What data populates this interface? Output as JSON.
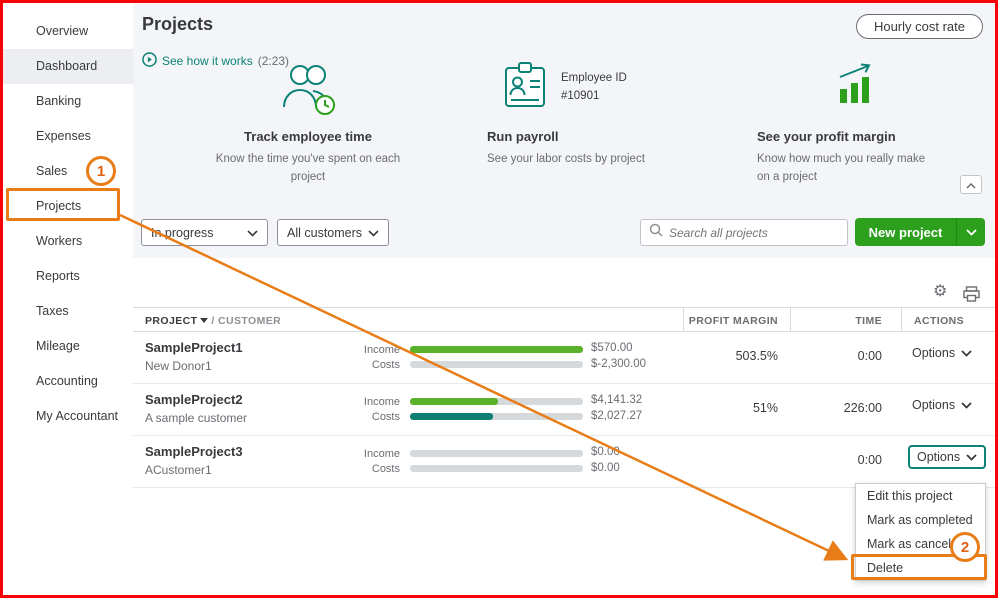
{
  "colors": {
    "accent_green": "#2ca01c",
    "teal": "#0c8276",
    "income_bar_green": "#5bb12a",
    "costs_bar_teal": "#0f7e72",
    "annotation_orange": "#e87d17",
    "frame_border_red": "#fb0007"
  },
  "sidebar": {
    "items": [
      {
        "label": "Overview"
      },
      {
        "label": "Dashboard"
      },
      {
        "label": "Banking"
      },
      {
        "label": "Expenses"
      },
      {
        "label": "Sales"
      },
      {
        "label": "Projects"
      },
      {
        "label": "Workers"
      },
      {
        "label": "Reports"
      },
      {
        "label": "Taxes"
      },
      {
        "label": "Mileage"
      },
      {
        "label": "Accounting"
      },
      {
        "label": "My Accountant"
      }
    ]
  },
  "header": {
    "title": "Projects",
    "hourly_cost_rate": "Hourly cost rate",
    "see_how_it_works": "See how it works",
    "video_duration": "(2:23)"
  },
  "features": {
    "track_time": {
      "title": "Track employee time",
      "desc": "Know the time you've spent on each project"
    },
    "payroll": {
      "title": "Run payroll",
      "desc": "See your labor costs by project",
      "card_line1": "Employee ID",
      "card_line2": "#10901"
    },
    "profit": {
      "title": "See your profit margin",
      "desc": "Know how much you really make on a project"
    }
  },
  "filters": {
    "status": "In progress",
    "customers": "All customers",
    "search_placeholder": "Search all projects",
    "new_project_label": "New project"
  },
  "table": {
    "headers": {
      "project": "PROJECT",
      "customer": "/ CUSTOMER",
      "profit_margin": "PROFIT MARGIN",
      "time": "TIME",
      "actions": "ACTIONS"
    },
    "income_label": "Income",
    "costs_label": "Costs",
    "options_label": "Options",
    "rows": [
      {
        "project": "SampleProject1",
        "customer": "New Donor1",
        "income_value": "$570.00",
        "costs_value": "$-2,300.00",
        "income_pct": 100,
        "costs_pct": 0,
        "margin": "503.5%",
        "time": "0:00"
      },
      {
        "project": "SampleProject2",
        "customer": "A sample customer",
        "income_value": "$4,141.32",
        "costs_value": "$2,027.27",
        "income_pct": 51,
        "costs_pct": 48,
        "margin": "51%",
        "time": "226:00"
      },
      {
        "project": "SampleProject3",
        "customer": "ACustomer1",
        "income_value": "$0.00",
        "costs_value": "$0.00",
        "income_pct": 0,
        "costs_pct": 0,
        "margin": "",
        "time": "0:00"
      }
    ]
  },
  "menu": {
    "items": [
      "Edit this project",
      "Mark as completed",
      "Mark as canceled",
      "Delete"
    ]
  },
  "annotations": {
    "step1": "1",
    "step2": "2"
  }
}
